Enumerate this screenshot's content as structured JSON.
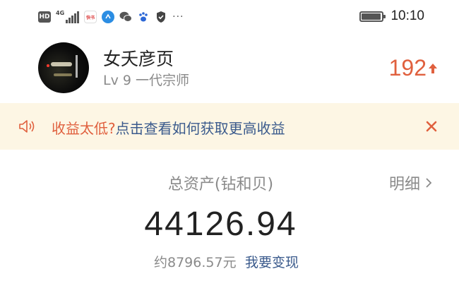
{
  "status_bar": {
    "hd_badge": "HD",
    "network_label": "4G",
    "book_app_label": "快书",
    "more_dots": "···",
    "time": "10:10",
    "battery_level": 0.95
  },
  "profile": {
    "username": "女夭彦页",
    "level": "Lv 9 一代宗师",
    "score": "192"
  },
  "banner": {
    "warning": "收益太低?",
    "link": "点击查看如何获取更高收益"
  },
  "assets": {
    "label": "总资产(钻和贝)",
    "detail": "明细",
    "total": "44126.94",
    "approx": "约8796.57元",
    "cashout": "我要变现"
  },
  "colors": {
    "accent_orange": "#e0603e",
    "link_blue": "#3a5a8c",
    "banner_bg": "#fdf6e4",
    "muted_gray": "#8a8a8a"
  }
}
